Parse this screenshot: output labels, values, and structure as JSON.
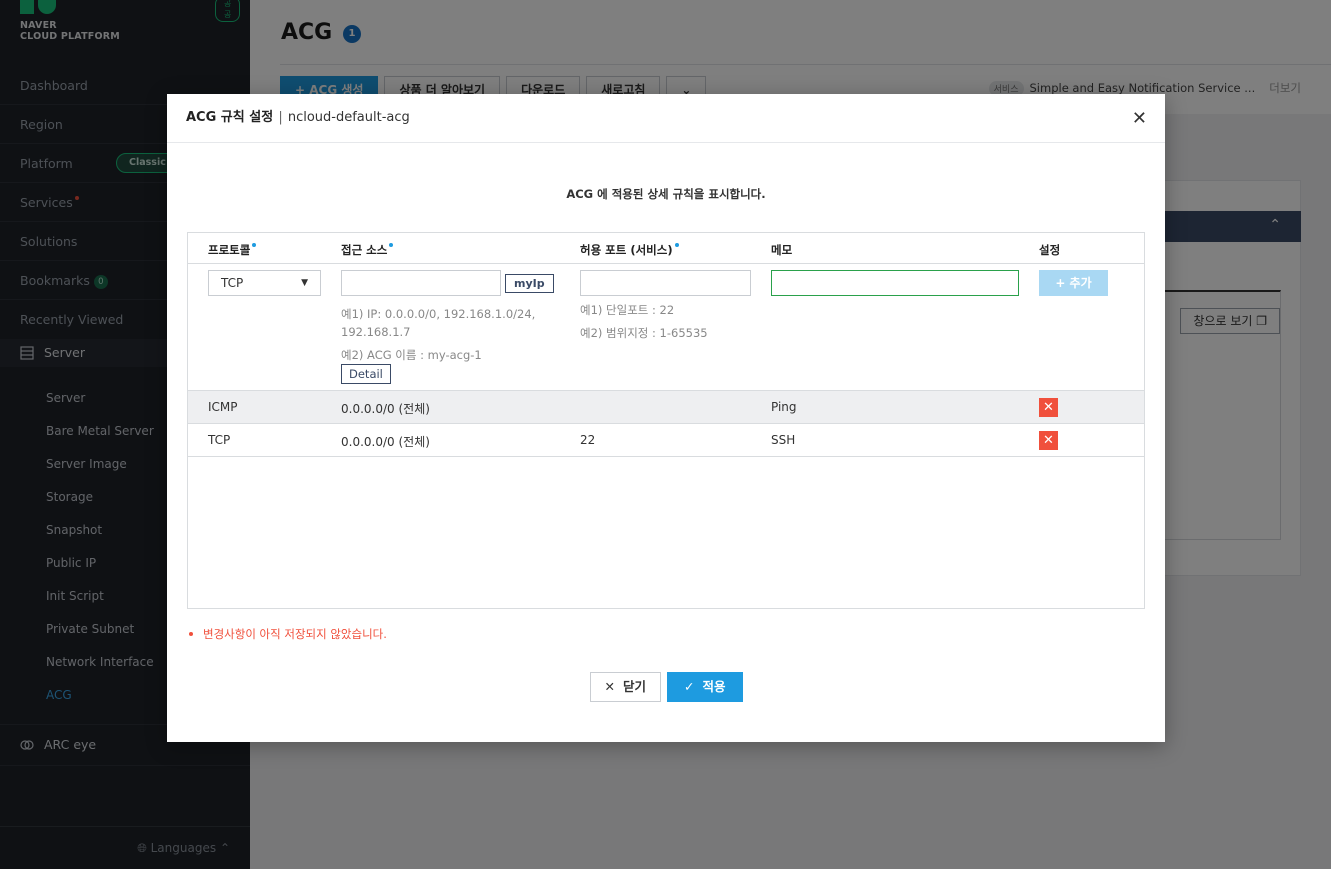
{
  "sidebar": {
    "logo_line1": "NAVER",
    "logo_line2": "CLOUD PLATFORM",
    "logo_badge": "공공",
    "items": [
      {
        "label": "Dashboard"
      },
      {
        "label": "Region"
      },
      {
        "label": "Platform",
        "badge": "Classic"
      },
      {
        "label": "Services"
      },
      {
        "label": "Solutions"
      },
      {
        "label": "Bookmarks",
        "count": "0"
      },
      {
        "label": "Recently Viewed"
      }
    ],
    "server_group": "Server",
    "sub_items": [
      "Server",
      "Bare Metal Server",
      "Server Image",
      "Storage",
      "Snapshot",
      "Public IP",
      "Init Script",
      "Private Subnet",
      "Network Interface",
      "ACG"
    ],
    "arc": "ARC eye",
    "languages": "Languages"
  },
  "main": {
    "title": "ACG",
    "title_count": "1",
    "toolbar": {
      "create": "+ ACG 생성",
      "learn_more": "상품 더 알아보기",
      "download": "다운로드",
      "refresh": "새로고침"
    },
    "notice": {
      "tag": "서비스",
      "text": "Simple and Easy Notification Service ...",
      "more": "더보기"
    },
    "card_button": "창으로 보기"
  },
  "modal": {
    "title": "ACG 규칙 설정",
    "separator": "|",
    "acg_name": "ncloud-default-acg",
    "description": "ACG 에 적용된 상세 규칙을 표시합니다.",
    "columns": {
      "protocol": "프로토콜",
      "source": "접근 소스",
      "port": "허용 포트 (서비스)",
      "memo": "메모",
      "settings": "설정"
    },
    "form": {
      "protocol_value": "TCP",
      "source_value": "",
      "myip_label": "myIp",
      "port_value": "",
      "memo_value": "",
      "add_label": "+ 추가",
      "source_hint1": "예1) IP: 0.0.0.0/0, 192.168.1.0/24, 192.168.1.7",
      "source_hint2": "예2) ACG 이름 : my-acg-1",
      "detail_label": "Detail",
      "port_hint1": "예1) 단일포트 : 22",
      "port_hint2": "예2) 범위지정 : 1-65535"
    },
    "rules": [
      {
        "protocol": "ICMP",
        "source": "0.0.0.0/0 (전체)",
        "port": "",
        "memo": "Ping"
      },
      {
        "protocol": "TCP",
        "source": "0.0.0.0/0 (전체)",
        "port": "22",
        "memo": "SSH"
      }
    ],
    "warning": "변경사항이 아직 저장되지 않았습니다.",
    "close_label": "닫기",
    "apply_label": "적용"
  },
  "colors": {
    "accent": "#1e9be0",
    "danger": "#f0503c",
    "sidebar_bg": "#1e2228",
    "brand_green": "#19c37d"
  }
}
